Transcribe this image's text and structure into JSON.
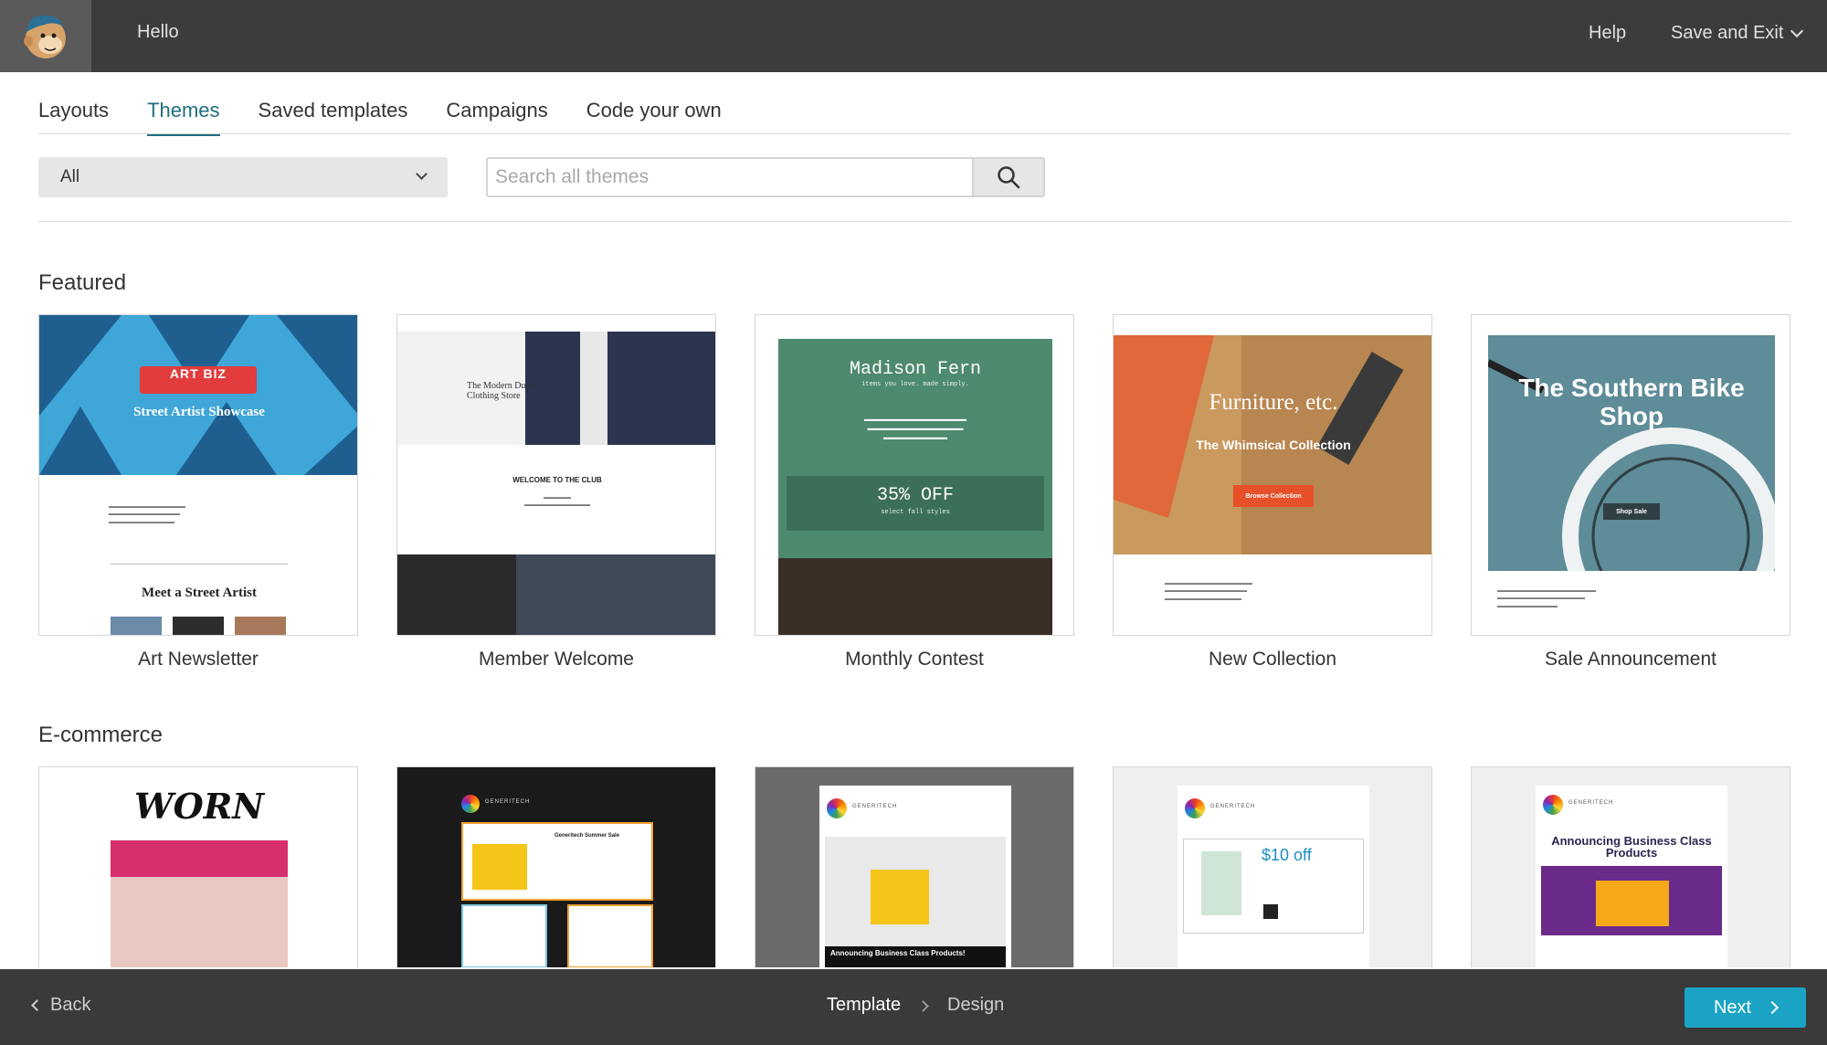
{
  "topbar": {
    "greeting": "Hello",
    "help_label": "Help",
    "save_exit_label": "Save and Exit"
  },
  "tabs": [
    {
      "label": "Layouts",
      "active": false
    },
    {
      "label": "Themes",
      "active": true
    },
    {
      "label": "Saved templates",
      "active": false
    },
    {
      "label": "Campaigns",
      "active": false
    },
    {
      "label": "Code your own",
      "active": false
    }
  ],
  "filters": {
    "category_selected": "All",
    "search_placeholder": "Search all themes"
  },
  "featured": {
    "title": "Featured",
    "cards": [
      {
        "label": "Art Newsletter",
        "preview": {
          "logo": "ART BIZ",
          "headline": "Street Artist Showcase",
          "subhead": "Meet a Street Artist"
        }
      },
      {
        "label": "Member Welcome",
        "preview": {
          "brand": "The Modern Dude Clothing Store",
          "headline": "WELCOME TO THE CLUB"
        }
      },
      {
        "label": "Monthly Contest",
        "preview": {
          "brand": "Madison Fern",
          "tagline": "items you love. made simply.",
          "offer": "35% OFF",
          "offer_sub": "select fall styles"
        }
      },
      {
        "label": "New Collection",
        "preview": {
          "headline": "Furniture, etc.",
          "subhead": "The Whimsical Collection",
          "button": "Browse Collection"
        }
      },
      {
        "label": "Sale Announcement",
        "preview": {
          "headline": "The Southern Bike Shop",
          "button": "Shop Sale"
        }
      }
    ]
  },
  "ecommerce": {
    "title": "E-commerce",
    "cards": [
      {
        "preview": {
          "headline": "WORN"
        }
      },
      {
        "preview": {
          "brand": "GENERITECH",
          "headline": "Generitech Summer Sale"
        }
      },
      {
        "preview": {
          "brand": "GENERITECH",
          "headline": "Announcing Business Class Products!"
        }
      },
      {
        "preview": {
          "brand": "GENERITECH",
          "offer": "$10 off"
        }
      },
      {
        "preview": {
          "brand": "GENERITECH",
          "headline": "Announcing Business Class Products"
        }
      }
    ]
  },
  "bottombar": {
    "back_label": "Back",
    "step_current": "Template",
    "step_next": "Design",
    "next_label": "Next"
  },
  "colors": {
    "accent": "#1aa3c5",
    "tab_active": "#1f6e7e",
    "topbar": "#3c3c3c"
  }
}
